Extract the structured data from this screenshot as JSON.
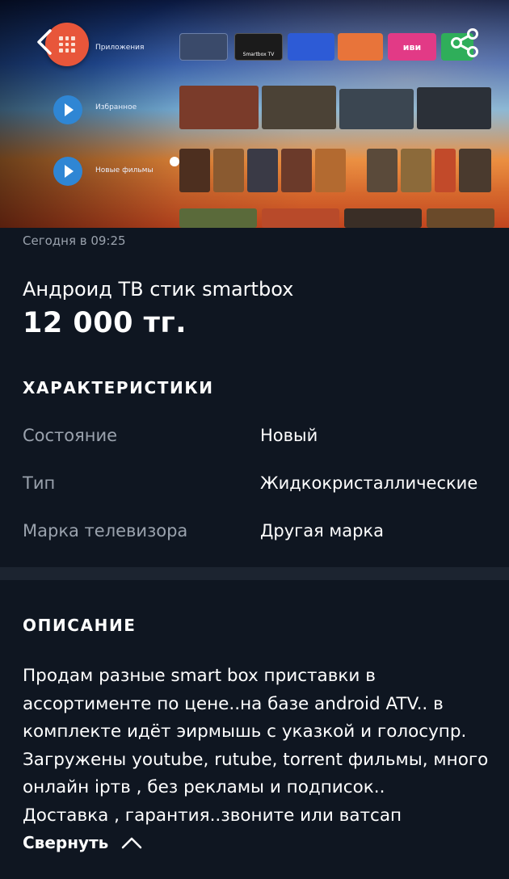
{
  "hero": {
    "tv_menu": [
      "Приложения",
      "Избранное",
      "Новые фильмы"
    ],
    "tv_apps": [
      "Smartbox TV",
      "иви"
    ],
    "icons": {
      "back": "chevron-left-icon",
      "share": "share-icon",
      "launcher": "grid-icon"
    }
  },
  "listing": {
    "date": "Сегодня в 09:25",
    "title": "Андроид ТВ стик smartbox",
    "price": "12 000 тг."
  },
  "specs": {
    "heading": "ХАРАКТЕРИСТИКИ",
    "rows": [
      {
        "label": "Состояние",
        "value": "Новый"
      },
      {
        "label": "Тип",
        "value": "Жидкокристаллические"
      },
      {
        "label": "Марка телевизора",
        "value": "Другая марка"
      }
    ]
  },
  "description": {
    "heading": "ОПИСАНИЕ",
    "lines": [
      "Продам разные smart box приставки в",
      "ассортименте по цене..на базе android ATV.. в",
      "комплекте идёт эирмышь с указкой и голосупр.",
      "Загружены youtube, rutube, torrent фильмы, много",
      "онлайн iртв , без рекламы и подписок..",
      "Доставка , гарантия..звоните или ватсап"
    ],
    "collapse_label": "Свернуть"
  },
  "colors": {
    "background": "#0f1621",
    "muted_text": "#9aa2ad",
    "divider": "#1c2430"
  }
}
